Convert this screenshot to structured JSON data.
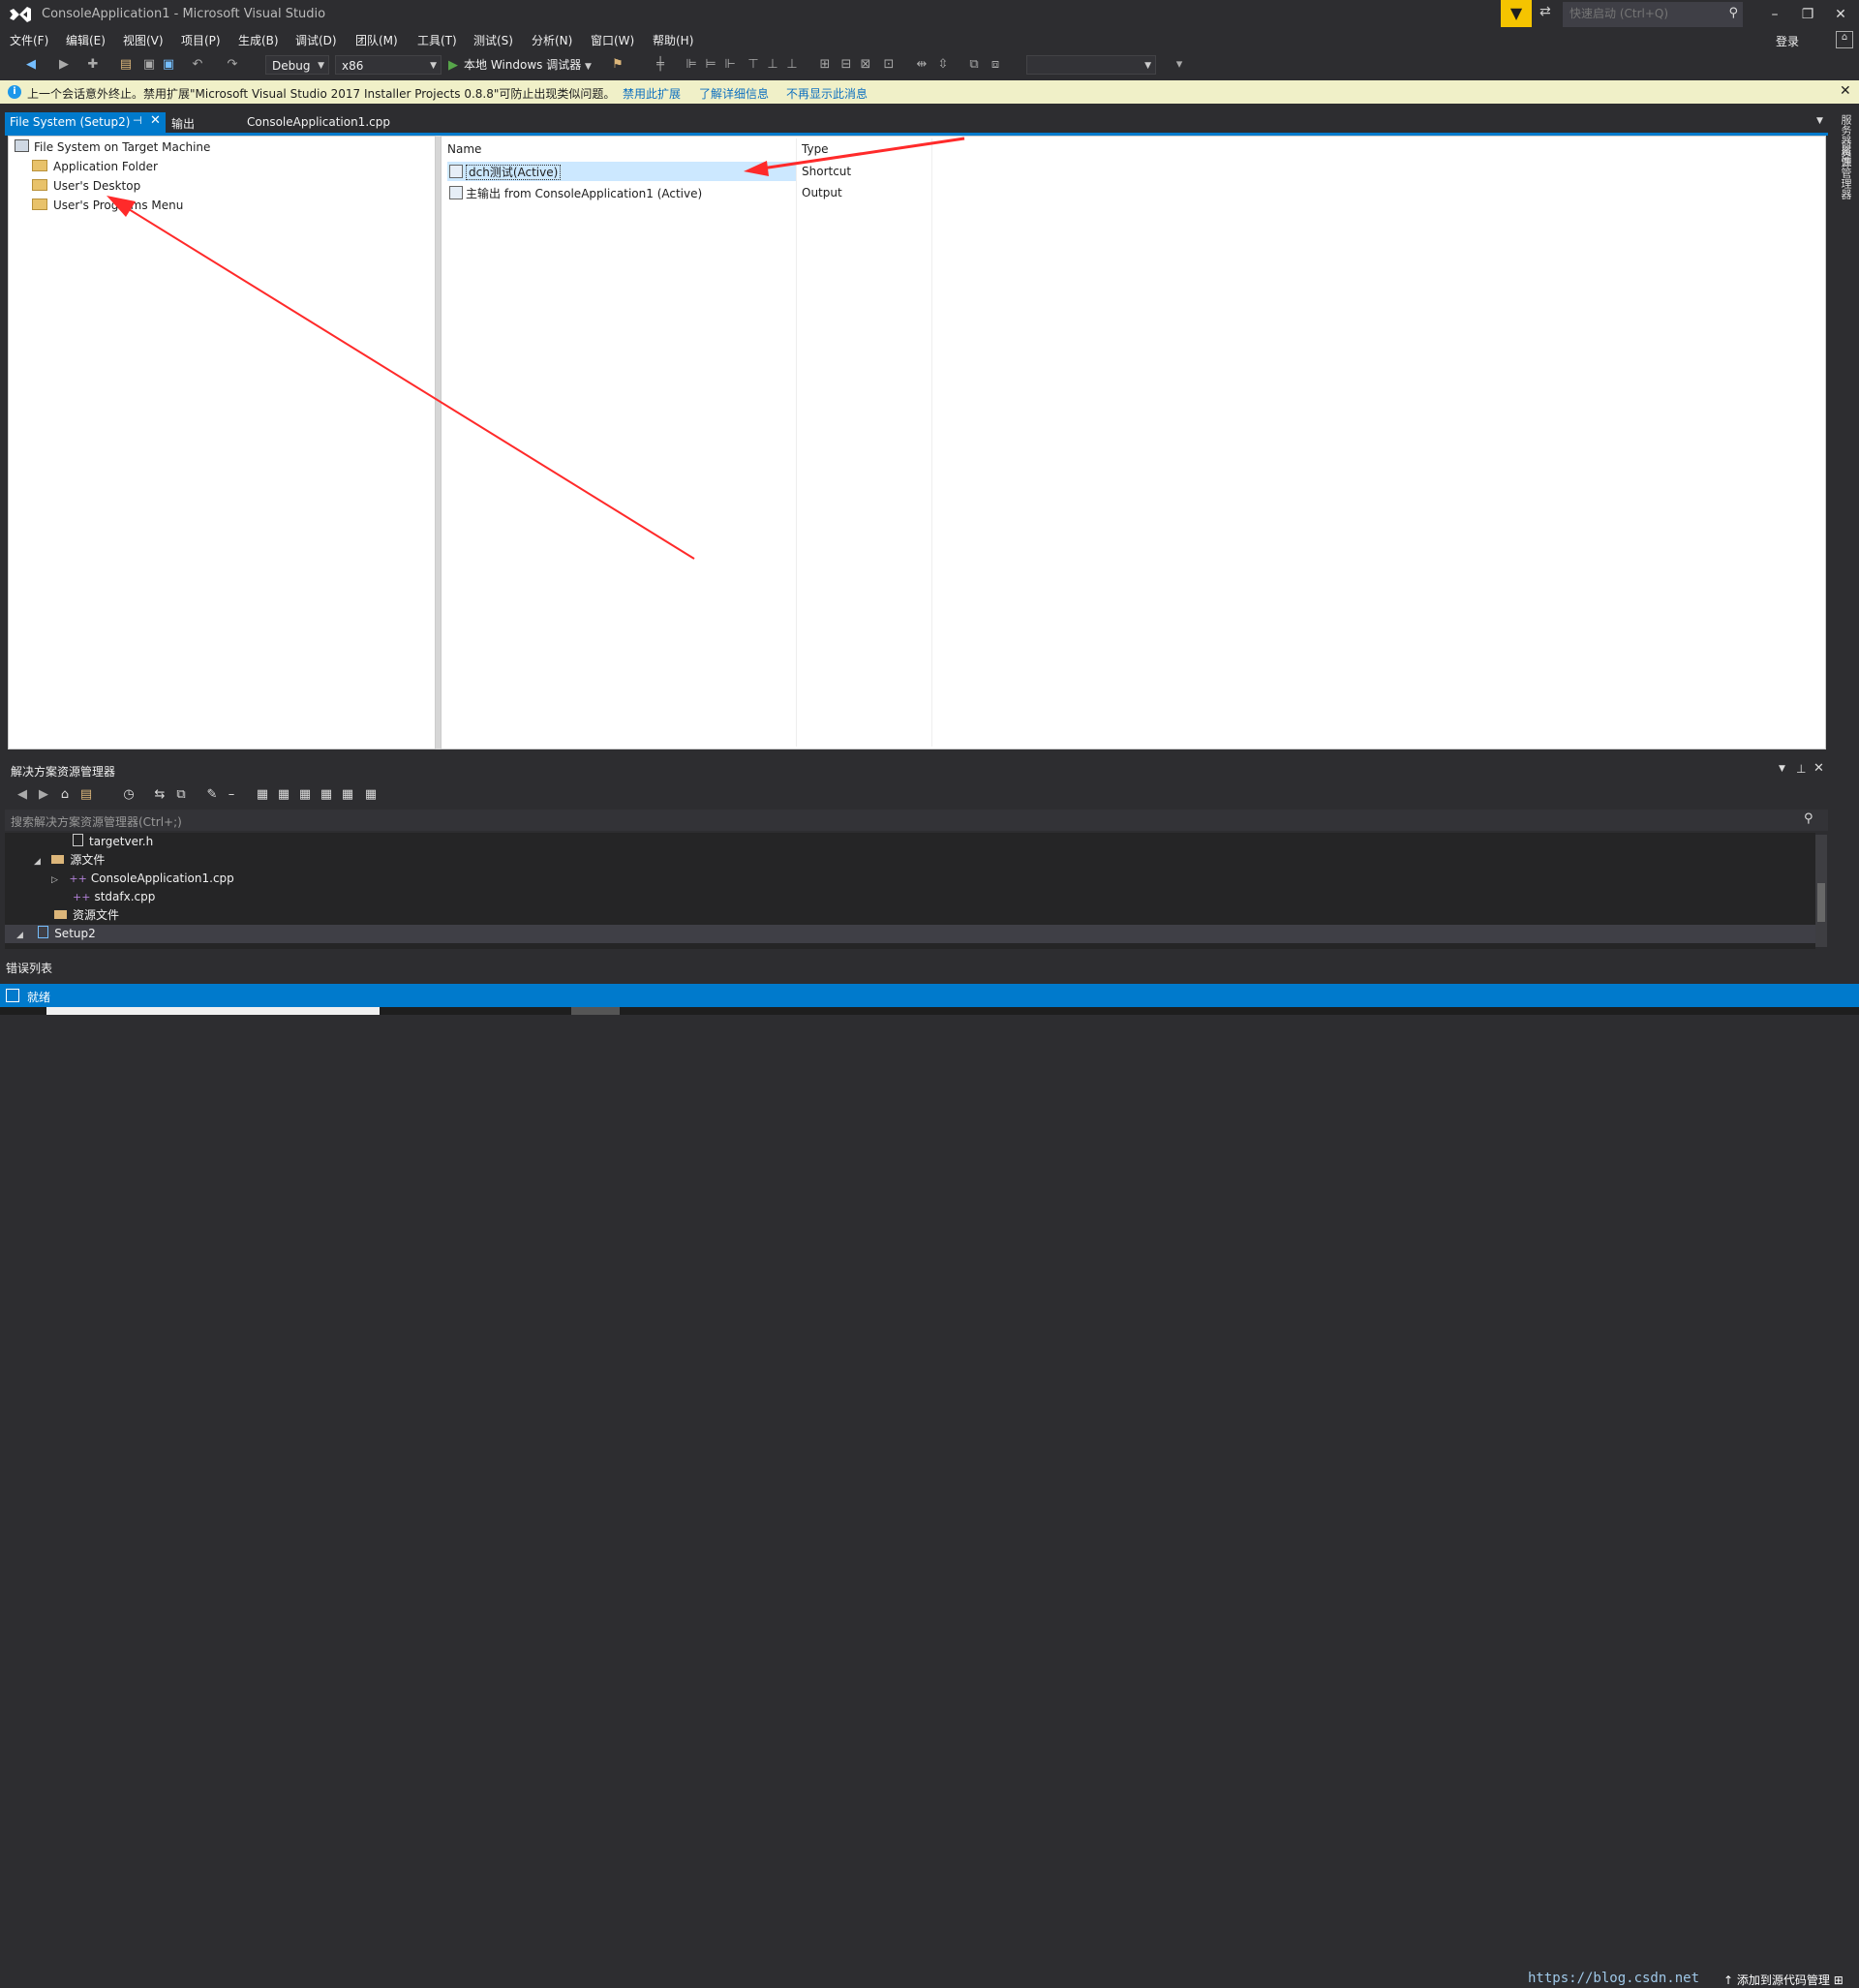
{
  "window": {
    "title": "ConsoleApplication1 - Microsoft Visual Studio",
    "quick_launch_placeholder": "快速启动 (Ctrl+Q)",
    "login": "登录"
  },
  "menu": [
    "文件(F)",
    "编辑(E)",
    "视图(V)",
    "项目(P)",
    "生成(B)",
    "调试(D)",
    "团队(M)",
    "工具(T)",
    "测试(S)",
    "分析(N)",
    "窗口(W)",
    "帮助(H)"
  ],
  "toolbar": {
    "config": "Debug",
    "platform": "x86",
    "run_label": "本地 Windows 调试器"
  },
  "infobar": {
    "message": "上一个会话意外终止。禁用扩展\"Microsoft Visual Studio 2017 Installer Projects 0.8.8\"可防止出现类似问题。",
    "links": [
      "禁用此扩展",
      "了解详细信息",
      "不再显示此消息"
    ]
  },
  "tabs": {
    "active": "File System (Setup2)",
    "output": "输出",
    "file": "ConsoleApplication1.cpp"
  },
  "right_panel": {
    "items": [
      "服务器资源管理器",
      "属性"
    ]
  },
  "file_system": {
    "tree": {
      "root": "File System on Target Machine",
      "children": [
        "Application Folder",
        "User's Desktop",
        "User's Programs Menu"
      ]
    },
    "list": {
      "columns": [
        "Name",
        "Type"
      ],
      "rows": [
        {
          "name": "dch测试(Active)",
          "type": "Shortcut"
        },
        {
          "name": "主输出 from ConsoleApplication1 (Active)",
          "type": "Output"
        }
      ]
    }
  },
  "solution_explorer": {
    "title": "解决方案资源管理器",
    "search_placeholder": "搜索解决方案资源管理器(Ctrl+;)",
    "rows": [
      "targetver.h",
      "源文件",
      "ConsoleApplication1.cpp",
      "stdafx.cpp",
      "资源文件",
      "Setup2"
    ]
  },
  "error_list": {
    "label": "错误列表"
  },
  "status": {
    "text": "就绪",
    "source_control": "添加到源代码管理",
    "watermark": "https://blog.csdn.net"
  },
  "colors": {
    "accent": "#007acc",
    "annotation_arrow": "#ff2a2a",
    "infobar_bg": "#f0f0c8",
    "selection": "#cce8ff"
  }
}
